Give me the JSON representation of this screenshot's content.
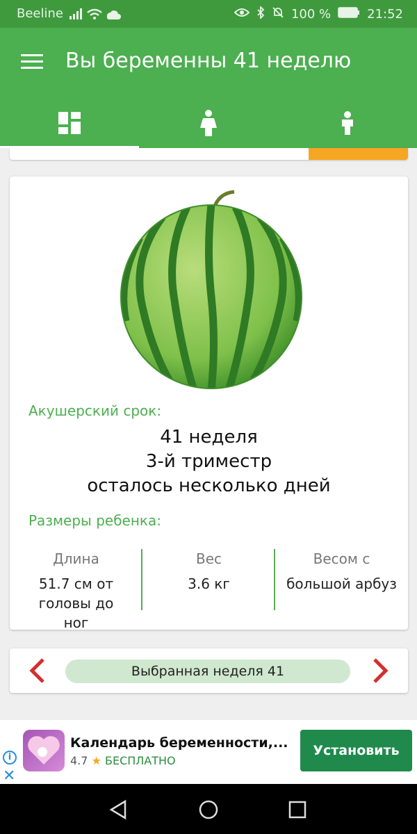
{
  "status_bar": {
    "carrier": "Beeline",
    "battery": "100 %",
    "time": "21:52"
  },
  "toolbar": {
    "title": "Вы беременны 41 неделю"
  },
  "tabs": [
    {
      "name": "dashboard",
      "icon": "grid-icon"
    },
    {
      "name": "mother",
      "icon": "woman-icon"
    },
    {
      "name": "baby",
      "icon": "child-icon"
    }
  ],
  "card": {
    "term_label": "Акушерский срок:",
    "week": "41 неделя",
    "trimester": "3-й триместр",
    "remaining": "осталось несколько дней",
    "sizes_label": "Размеры ребенка:",
    "length_header": "Длина",
    "length_value": "51.7 см от головы до ног",
    "weight_header": "Вес",
    "weight_value": "3.6 кг",
    "compare_header": "Весом с",
    "compare_value": "большой арбуз"
  },
  "week_selector": {
    "label": "Выбранная неделя 41"
  },
  "ad": {
    "app_name": "Календарь беременности,...",
    "rating": "4.7",
    "price": "БЕСПЛАТНО",
    "install": "Установить"
  },
  "colors": {
    "primary": "#4caf50",
    "status": "#3f9a3d",
    "accent": "#f5a623",
    "arrow": "#d32f2f"
  }
}
